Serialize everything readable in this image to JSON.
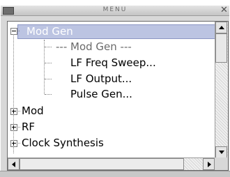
{
  "window": {
    "title": "MENU"
  },
  "tree": {
    "selected_label": "Mod Gen",
    "children": [
      {
        "label": "--- Mod Gen ---"
      },
      {
        "label": "LF Freq Sweep..."
      },
      {
        "label": "LF Output..."
      },
      {
        "label": "Pulse Gen..."
      }
    ],
    "collapsed_nodes": [
      {
        "label": "Mod"
      },
      {
        "label": "RF"
      },
      {
        "label": "Clock Synthesis"
      }
    ]
  },
  "colors": {
    "selection": "#bcc4e2",
    "window_bg": "#d8d8d8"
  }
}
